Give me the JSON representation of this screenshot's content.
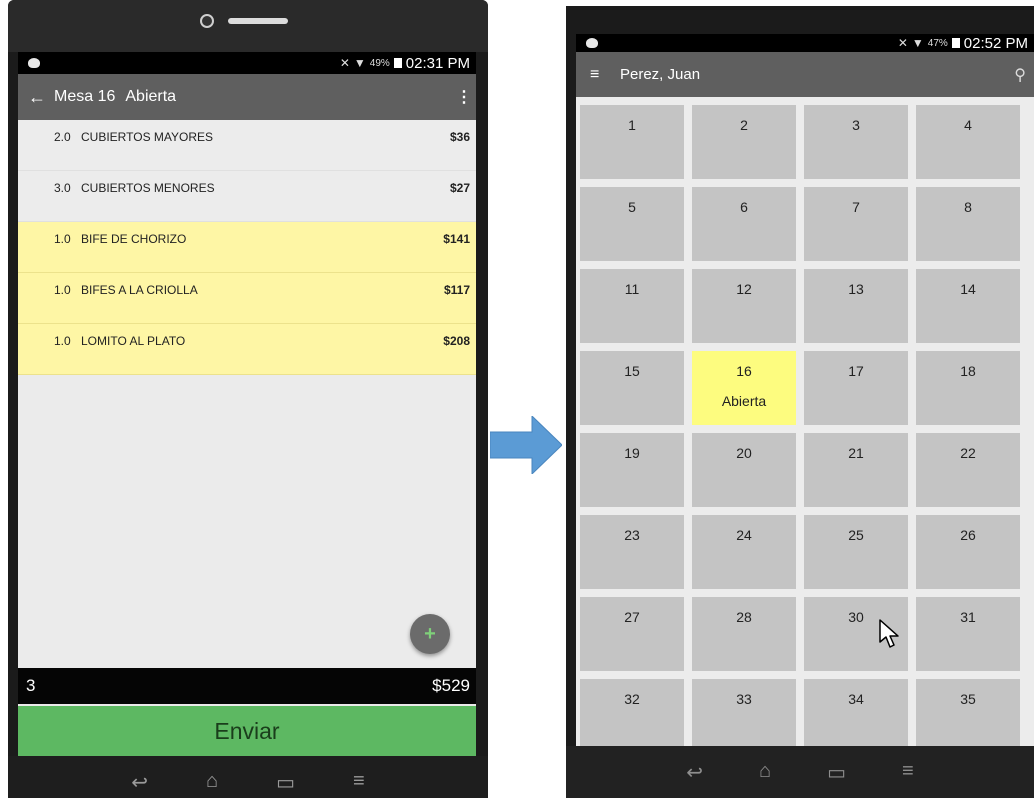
{
  "left_phone": {
    "status_time": "02:31 PM",
    "battery_pct": "49%",
    "app_bar": {
      "back_icon": "arrow-left-icon",
      "table_label": "Mesa 16",
      "status": "Abierta",
      "overflow_icon": "more-vert-icon"
    },
    "order_items": [
      {
        "qty": "2.0",
        "desc": "CUBIERTOS MAYORES",
        "price": "$36",
        "highlight": false
      },
      {
        "qty": "3.0",
        "desc": "CUBIERTOS MENORES",
        "price": "$27",
        "highlight": false
      },
      {
        "qty": "1.0",
        "desc": "BIFE DE CHORIZO",
        "price": "$141",
        "highlight": true
      },
      {
        "qty": "1.0",
        "desc": "BIFES A LA CRIOLLA",
        "price": "$117",
        "highlight": true
      },
      {
        "qty": "1.0",
        "desc": "LOMITO AL PLATO",
        "price": "$208",
        "highlight": true
      }
    ],
    "fab_label": "+",
    "totals": {
      "count": "3",
      "amount": "$529"
    },
    "send_label": "Enviar"
  },
  "right_phone": {
    "status_time": "02:52 PM",
    "battery_pct": "47%",
    "app_bar": {
      "menu_icon": "menu-icon",
      "user_name": "Perez, Juan",
      "search_icon": "search-icon"
    },
    "tables": [
      {
        "number": "1",
        "state": ""
      },
      {
        "number": "2",
        "state": ""
      },
      {
        "number": "3",
        "state": ""
      },
      {
        "number": "4",
        "state": ""
      },
      {
        "number": "5",
        "state": ""
      },
      {
        "number": "6",
        "state": ""
      },
      {
        "number": "7",
        "state": ""
      },
      {
        "number": "8",
        "state": ""
      },
      {
        "number": "11",
        "state": ""
      },
      {
        "number": "12",
        "state": ""
      },
      {
        "number": "13",
        "state": ""
      },
      {
        "number": "14",
        "state": ""
      },
      {
        "number": "15",
        "state": ""
      },
      {
        "number": "16",
        "state": "Abierta"
      },
      {
        "number": "17",
        "state": ""
      },
      {
        "number": "18",
        "state": ""
      },
      {
        "number": "19",
        "state": ""
      },
      {
        "number": "20",
        "state": ""
      },
      {
        "number": "21",
        "state": ""
      },
      {
        "number": "22",
        "state": ""
      },
      {
        "number": "23",
        "state": ""
      },
      {
        "number": "24",
        "state": ""
      },
      {
        "number": "25",
        "state": ""
      },
      {
        "number": "26",
        "state": ""
      },
      {
        "number": "27",
        "state": ""
      },
      {
        "number": "28",
        "state": ""
      },
      {
        "number": "30",
        "state": ""
      },
      {
        "number": "31",
        "state": ""
      },
      {
        "number": "32",
        "state": ""
      },
      {
        "number": "33",
        "state": ""
      },
      {
        "number": "34",
        "state": ""
      },
      {
        "number": "35",
        "state": ""
      }
    ]
  },
  "colors": {
    "app_bar": "#5f5f5f",
    "highlight_row": "#fef6a5",
    "open_table": "#fdfc7f",
    "table_cell": "#c4c4c4",
    "send_button": "#5db862",
    "arrow": "#5b9bd5"
  }
}
